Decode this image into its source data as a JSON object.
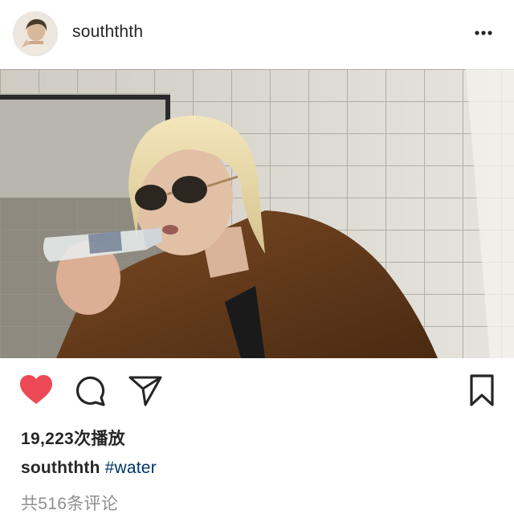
{
  "post": {
    "username": "souththth",
    "views_text": "19,223次播放",
    "caption": {
      "username": "souththth",
      "hashtag": "#water"
    },
    "comments_text": "共516条评论"
  },
  "icons": {
    "like": "heart-filled-icon",
    "comment": "comment-bubble-icon",
    "share": "paper-plane-icon",
    "save": "bookmark-icon",
    "more": "more-horizontal-icon"
  },
  "colors": {
    "heart": "#ed4956",
    "hashtag": "#003569",
    "comments": "#8e8e8e",
    "text": "#262626"
  }
}
